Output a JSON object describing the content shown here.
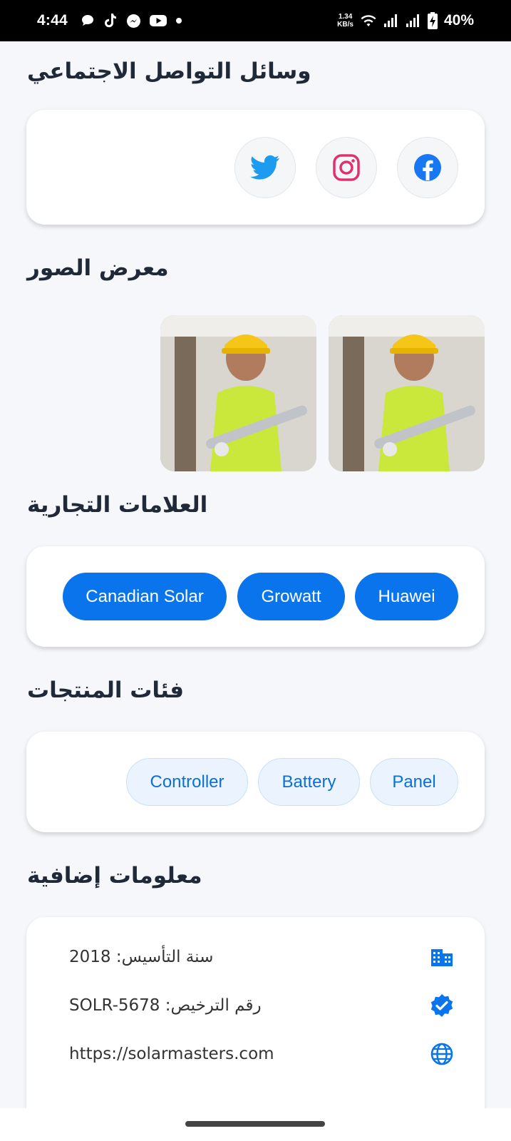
{
  "status_bar": {
    "time": "4:44",
    "speed_value": "1.34",
    "speed_unit": "KB/s",
    "battery": "40%"
  },
  "sections": {
    "social": {
      "title": "وسائل التواصل الاجتماعي"
    },
    "gallery": {
      "title": "معرض الصور"
    },
    "brands": {
      "title": "العلامات التجارية"
    },
    "categories": {
      "title": "فئات المنتجات"
    },
    "info": {
      "title": "معلومات إضافية"
    }
  },
  "social_links": [
    {
      "icon": "facebook-icon",
      "color": "#1877f2"
    },
    {
      "icon": "instagram-icon",
      "color": "#e1306c"
    },
    {
      "icon": "twitter-icon",
      "color": "#1da1f2"
    }
  ],
  "brands": [
    "Huawei",
    "Growatt",
    "Canadian Solar"
  ],
  "categories": [
    "Panel",
    "Battery",
    "Controller"
  ],
  "info_rows": [
    {
      "icon": "building-icon",
      "text": "سنة التأسيس: 2018"
    },
    {
      "icon": "verified-icon",
      "text": "رقم الترخيص: SOLR-5678"
    },
    {
      "icon": "globe-icon",
      "text": "https://solarmasters.com"
    }
  ],
  "colors": {
    "accent": "#0a74ec",
    "chip_bg": "#ebf4fe",
    "background": "#f5f7fa"
  }
}
